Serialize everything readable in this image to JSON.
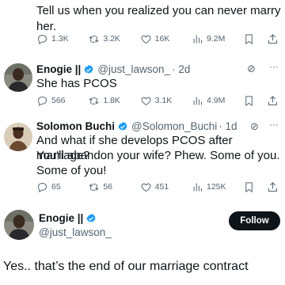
{
  "tweet0": {
    "text_line1": "Tell us when you realized you can never marry",
    "text_line2": "her.",
    "replies": "1.3K",
    "retweets": "3.2K",
    "likes": "16K",
    "views": "9.2M"
  },
  "tweet1": {
    "name": "Enogie ||",
    "handle": "@just_lawson_",
    "time": "· 2d",
    "text": "She has PCOS",
    "replies": "566",
    "retweets": "1.8K",
    "likes": "3.1K",
    "views": "4.9M"
  },
  "tweet2": {
    "name": "Solomon Buchi",
    "handle": "@Solomon_Buchi",
    "time": "· 1d",
    "text_line1": "And what if she develops PCOS after marriage?",
    "text_line2": "You'll abandon your wife? Phew. Some of you.",
    "text_line3": "Some of you!",
    "replies": "65",
    "retweets": "56",
    "likes": "451",
    "views": "125K"
  },
  "main_tweet": {
    "name": "Enogie ||",
    "handle": "@just_lawson_",
    "follow_label": "Follow",
    "text": "Yes.. that’s the end of our marriage contract"
  },
  "colors": {
    "verified": "#1d9bf0",
    "text": "#0f1419",
    "muted": "#536471",
    "follow_bg": "#0f1419"
  },
  "icons": [
    "reply-icon",
    "retweet-icon",
    "like-icon",
    "views-icon",
    "bookmark-icon",
    "share-icon",
    "verified-badge-icon",
    "grok-icon",
    "more-icon"
  ]
}
